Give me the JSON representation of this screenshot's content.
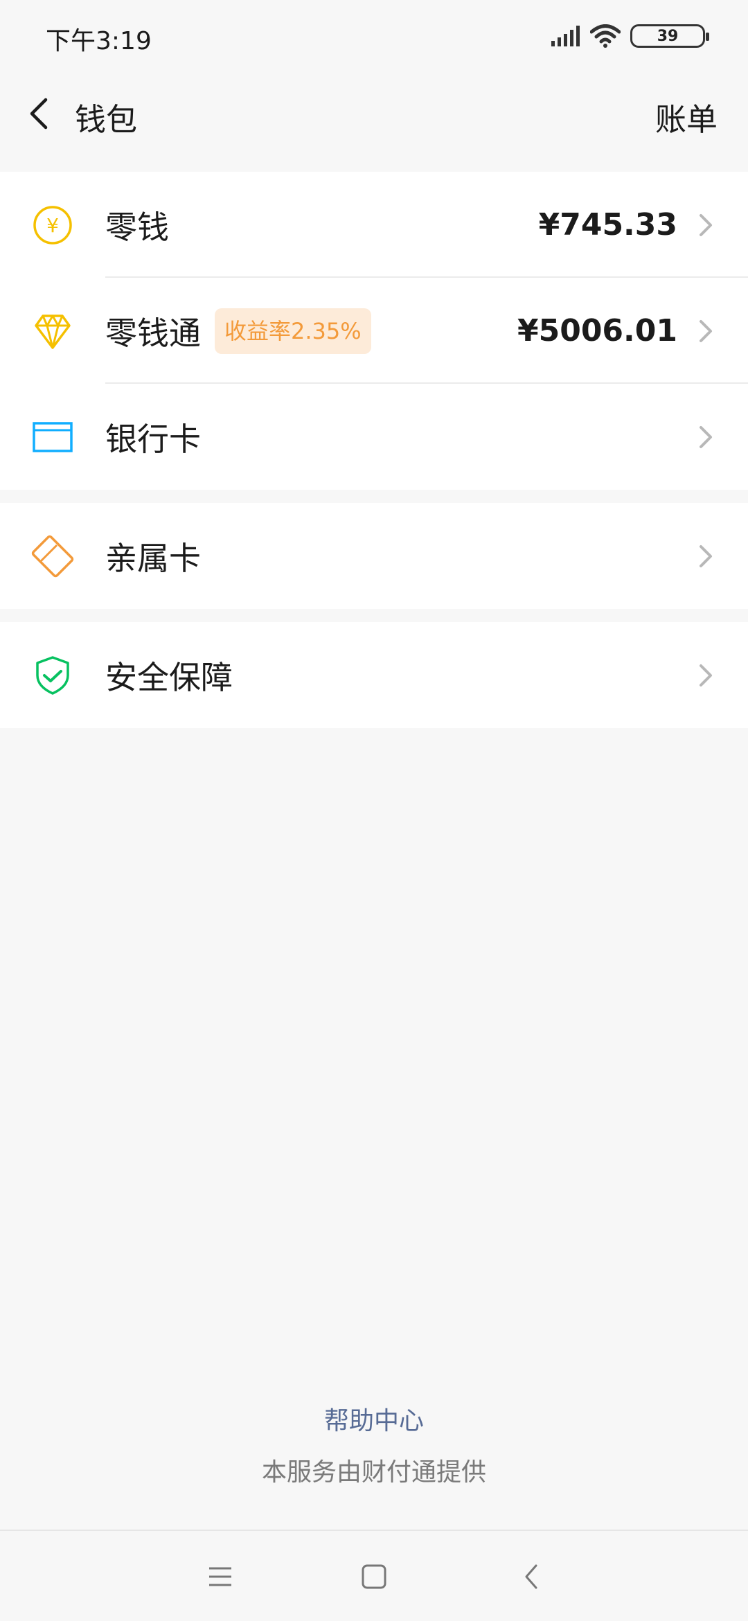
{
  "status_bar": {
    "time": "下午3:19",
    "battery": "39",
    "icons": [
      "signal-icon",
      "wifi-icon",
      "battery-icon"
    ]
  },
  "nav": {
    "title": "钱包",
    "bill_label": "账单",
    "back_icon": "chevron-left-icon"
  },
  "items": [
    {
      "label": "零钱",
      "amount": "¥745.33",
      "icon": "yuan-coin-icon",
      "icon_color": "#f5c000"
    },
    {
      "label": "零钱通",
      "badge": "收益率2.35%",
      "amount": "¥5006.01",
      "icon": "diamond-icon",
      "icon_color": "#f5c000"
    },
    {
      "label": "银行卡",
      "icon": "bank-card-icon",
      "icon_color": "#10aeff"
    },
    {
      "label": "亲属卡",
      "icon": "family-card-icon",
      "icon_color": "#f39a3a"
    },
    {
      "label": "安全保障",
      "icon": "shield-check-icon",
      "icon_color": "#07c160"
    }
  ],
  "footer": {
    "help_link": "帮助中心",
    "provider": "本服务由财付通提供"
  },
  "system_nav": [
    "menu-icon",
    "home-icon",
    "back-icon"
  ],
  "colors": {
    "background": "#f7f7f7",
    "link": "#576b95",
    "badge_bg": "#fdebd9",
    "badge_text": "#f39a3a"
  }
}
